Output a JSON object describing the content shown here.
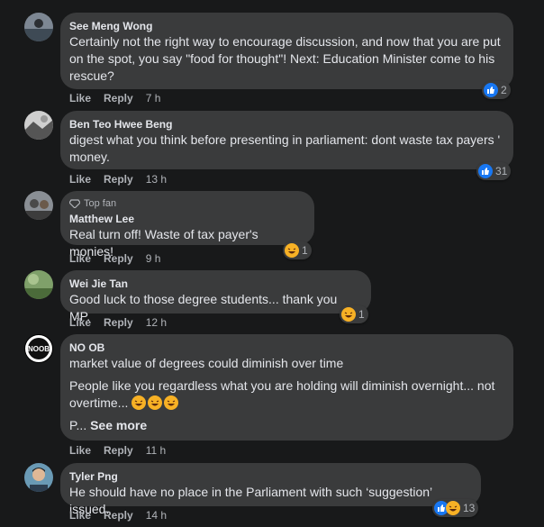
{
  "actions": {
    "like": "Like",
    "reply": "Reply"
  },
  "comments": [
    {
      "author": "See Meng Wong",
      "text": "Certainly not the right way to encourage discussion, and now that you are put on the spot, you say \"food for thought\"! Next: Education Minister come to his rescue?",
      "time": "7 h",
      "reaction_count": "2",
      "reactions": [
        "like"
      ]
    },
    {
      "author": "Ben Teo Hwee Beng",
      "text": "digest what you think before presenting in parliament: dont waste tax payers ' money.",
      "time": "13 h",
      "reaction_count": "31",
      "reactions": [
        "like"
      ]
    },
    {
      "badge": "Top fan",
      "author": "Matthew Lee",
      "text": "Real turn off! Waste of tax payer's monies!",
      "time": "9 h",
      "reaction_count": "1",
      "reactions": [
        "haha"
      ]
    },
    {
      "author": "Wei Jie Tan",
      "text": "Good luck to those degree students... thank you MP.",
      "time": "12 h",
      "reaction_count": "1",
      "reactions": [
        "haha"
      ]
    },
    {
      "author": "NO OB",
      "avatar_text": "NOOB",
      "text": "market value of degrees could diminish over time",
      "text2": "People like you regardless what you are holding will diminish overnight... not overtime...",
      "text3_prefix": "P...",
      "see_more": "See more",
      "time": "11 h"
    },
    {
      "author": "Tyler Png",
      "text": "He should have no place in the Parliament with such ‘suggestion’ issued.",
      "time": "14 h",
      "reaction_count": "13",
      "reactions": [
        "like",
        "haha"
      ]
    }
  ]
}
